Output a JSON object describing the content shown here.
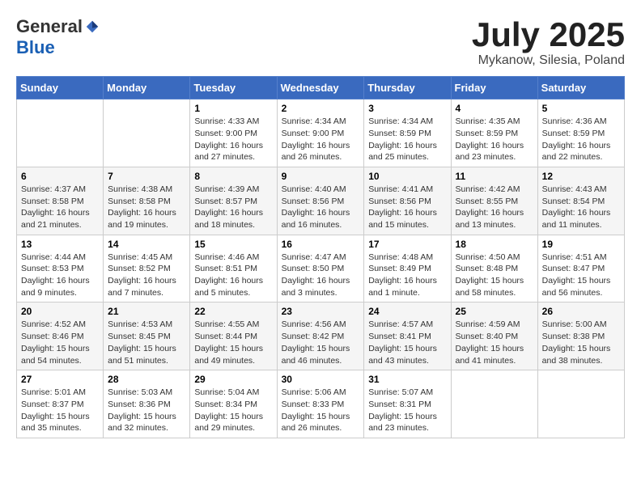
{
  "header": {
    "logo_general": "General",
    "logo_blue": "Blue",
    "month_title": "July 2025",
    "subtitle": "Mykanow, Silesia, Poland"
  },
  "days_of_week": [
    "Sunday",
    "Monday",
    "Tuesday",
    "Wednesday",
    "Thursday",
    "Friday",
    "Saturday"
  ],
  "weeks": [
    [
      {
        "day": "",
        "info": ""
      },
      {
        "day": "",
        "info": ""
      },
      {
        "day": "1",
        "info": "Sunrise: 4:33 AM\nSunset: 9:00 PM\nDaylight: 16 hours and 27 minutes."
      },
      {
        "day": "2",
        "info": "Sunrise: 4:34 AM\nSunset: 9:00 PM\nDaylight: 16 hours and 26 minutes."
      },
      {
        "day": "3",
        "info": "Sunrise: 4:34 AM\nSunset: 8:59 PM\nDaylight: 16 hours and 25 minutes."
      },
      {
        "day": "4",
        "info": "Sunrise: 4:35 AM\nSunset: 8:59 PM\nDaylight: 16 hours and 23 minutes."
      },
      {
        "day": "5",
        "info": "Sunrise: 4:36 AM\nSunset: 8:59 PM\nDaylight: 16 hours and 22 minutes."
      }
    ],
    [
      {
        "day": "6",
        "info": "Sunrise: 4:37 AM\nSunset: 8:58 PM\nDaylight: 16 hours and 21 minutes."
      },
      {
        "day": "7",
        "info": "Sunrise: 4:38 AM\nSunset: 8:58 PM\nDaylight: 16 hours and 19 minutes."
      },
      {
        "day": "8",
        "info": "Sunrise: 4:39 AM\nSunset: 8:57 PM\nDaylight: 16 hours and 18 minutes."
      },
      {
        "day": "9",
        "info": "Sunrise: 4:40 AM\nSunset: 8:56 PM\nDaylight: 16 hours and 16 minutes."
      },
      {
        "day": "10",
        "info": "Sunrise: 4:41 AM\nSunset: 8:56 PM\nDaylight: 16 hours and 15 minutes."
      },
      {
        "day": "11",
        "info": "Sunrise: 4:42 AM\nSunset: 8:55 PM\nDaylight: 16 hours and 13 minutes."
      },
      {
        "day": "12",
        "info": "Sunrise: 4:43 AM\nSunset: 8:54 PM\nDaylight: 16 hours and 11 minutes."
      }
    ],
    [
      {
        "day": "13",
        "info": "Sunrise: 4:44 AM\nSunset: 8:53 PM\nDaylight: 16 hours and 9 minutes."
      },
      {
        "day": "14",
        "info": "Sunrise: 4:45 AM\nSunset: 8:52 PM\nDaylight: 16 hours and 7 minutes."
      },
      {
        "day": "15",
        "info": "Sunrise: 4:46 AM\nSunset: 8:51 PM\nDaylight: 16 hours and 5 minutes."
      },
      {
        "day": "16",
        "info": "Sunrise: 4:47 AM\nSunset: 8:50 PM\nDaylight: 16 hours and 3 minutes."
      },
      {
        "day": "17",
        "info": "Sunrise: 4:48 AM\nSunset: 8:49 PM\nDaylight: 16 hours and 1 minute."
      },
      {
        "day": "18",
        "info": "Sunrise: 4:50 AM\nSunset: 8:48 PM\nDaylight: 15 hours and 58 minutes."
      },
      {
        "day": "19",
        "info": "Sunrise: 4:51 AM\nSunset: 8:47 PM\nDaylight: 15 hours and 56 minutes."
      }
    ],
    [
      {
        "day": "20",
        "info": "Sunrise: 4:52 AM\nSunset: 8:46 PM\nDaylight: 15 hours and 54 minutes."
      },
      {
        "day": "21",
        "info": "Sunrise: 4:53 AM\nSunset: 8:45 PM\nDaylight: 15 hours and 51 minutes."
      },
      {
        "day": "22",
        "info": "Sunrise: 4:55 AM\nSunset: 8:44 PM\nDaylight: 15 hours and 49 minutes."
      },
      {
        "day": "23",
        "info": "Sunrise: 4:56 AM\nSunset: 8:42 PM\nDaylight: 15 hours and 46 minutes."
      },
      {
        "day": "24",
        "info": "Sunrise: 4:57 AM\nSunset: 8:41 PM\nDaylight: 15 hours and 43 minutes."
      },
      {
        "day": "25",
        "info": "Sunrise: 4:59 AM\nSunset: 8:40 PM\nDaylight: 15 hours and 41 minutes."
      },
      {
        "day": "26",
        "info": "Sunrise: 5:00 AM\nSunset: 8:38 PM\nDaylight: 15 hours and 38 minutes."
      }
    ],
    [
      {
        "day": "27",
        "info": "Sunrise: 5:01 AM\nSunset: 8:37 PM\nDaylight: 15 hours and 35 minutes."
      },
      {
        "day": "28",
        "info": "Sunrise: 5:03 AM\nSunset: 8:36 PM\nDaylight: 15 hours and 32 minutes."
      },
      {
        "day": "29",
        "info": "Sunrise: 5:04 AM\nSunset: 8:34 PM\nDaylight: 15 hours and 29 minutes."
      },
      {
        "day": "30",
        "info": "Sunrise: 5:06 AM\nSunset: 8:33 PM\nDaylight: 15 hours and 26 minutes."
      },
      {
        "day": "31",
        "info": "Sunrise: 5:07 AM\nSunset: 8:31 PM\nDaylight: 15 hours and 23 minutes."
      },
      {
        "day": "",
        "info": ""
      },
      {
        "day": "",
        "info": ""
      }
    ]
  ]
}
